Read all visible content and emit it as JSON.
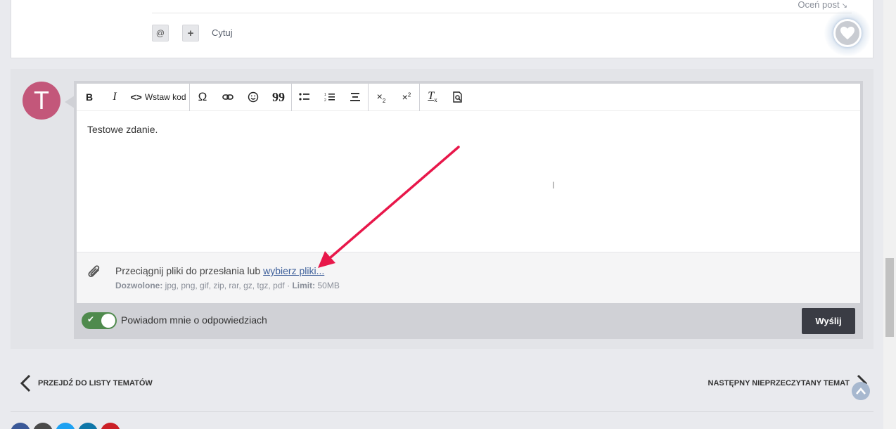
{
  "previous_post": {
    "rate_label": "Oceń post",
    "mention_label": "@",
    "plus_label": "+",
    "quote_label": "Cytuj"
  },
  "reply": {
    "avatar_letter": "T",
    "toolbar": {
      "bold": "B",
      "italic": "I",
      "code_label": "Wstaw kod",
      "omega": "Ω",
      "quote_marks": "99"
    },
    "content_text": "Testowe zdanie.",
    "attachments": {
      "drop_text": "Przeciągnij pliki do przesłania lub",
      "choose_link": "wybierz pliki...",
      "allowed_label": "Dozwolone:",
      "allowed_types": "jpg, png, gif, zip, rar, gz, tgz, pdf",
      "separator": "·",
      "limit_label": "Limit:",
      "limit_value": "50MB"
    },
    "notify_label": "Powiadom mnie o odpowiedziach",
    "notify_enabled": true,
    "send_label": "Wyślij"
  },
  "navigation": {
    "prev_label": "PRZEJDŹ DO LISTY TEMATÓW",
    "next_label": "NASTĘPNY NIEPRZECZYTANY TEMAT"
  },
  "colors": {
    "avatar": "#c3577a",
    "toggle_on": "#4f8a4d",
    "send_button": "#3a3c44",
    "annotation_arrow": "#e8174a",
    "link": "#3d5f9a"
  },
  "social_icons": [
    "facebook-icon",
    "share-icon",
    "twitter-icon",
    "linkedin-icon",
    "pinterest-icon"
  ]
}
